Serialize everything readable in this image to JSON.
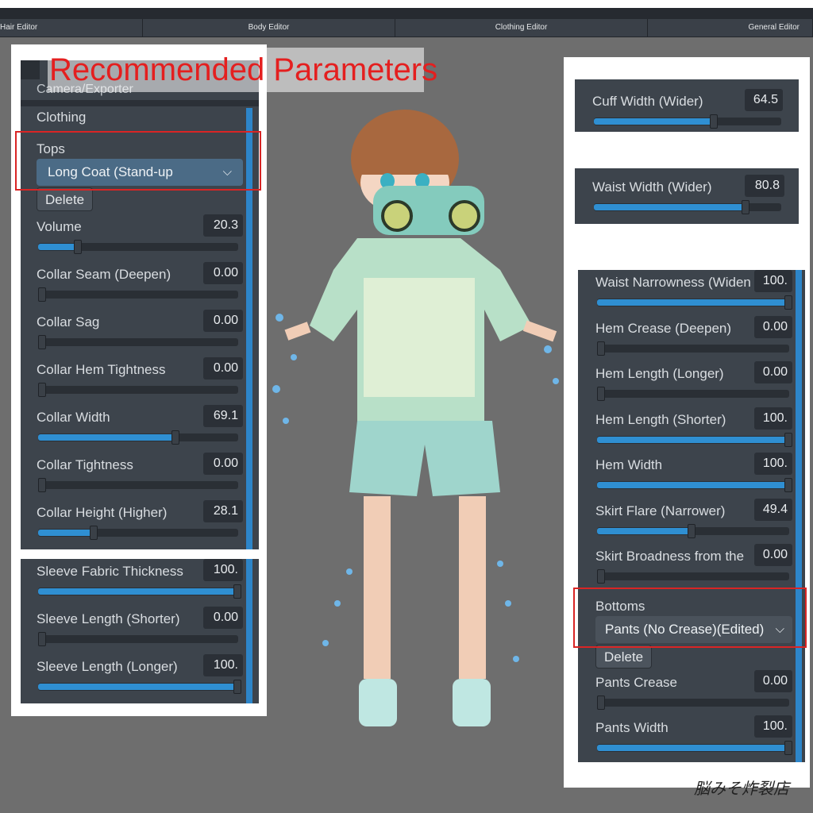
{
  "tabs": [
    "Hair Editor",
    "Body Editor",
    "Clothing Editor",
    "General Editor"
  ],
  "overlay_title": "Recommended  Parameters",
  "left": {
    "header_cut": "Camera/Exporter",
    "section": "Clothing",
    "tops_label": "Tops",
    "tops_value": "Long Coat (Stand-up",
    "delete_label": "Delete",
    "sliders": [
      {
        "label": "Volume",
        "value": "20.3",
        "fill": 0.203
      },
      {
        "label": "Collar Seam (Deepen)",
        "value": "0.00",
        "fill": 0
      },
      {
        "label": "Collar Sag",
        "value": "0.00",
        "fill": 0
      },
      {
        "label": "Collar Hem Tightness",
        "value": "0.00",
        "fill": 0
      },
      {
        "label": "Collar Width",
        "value": "69.1",
        "fill": 0.691
      },
      {
        "label": "Collar Tightness",
        "value": "0.00",
        "fill": 0
      },
      {
        "label": "Collar Height (Higher)",
        "value": "28.1",
        "fill": 0.281
      }
    ]
  },
  "left_bottom": {
    "sliders": [
      {
        "label": "Sleeve Fabric Thickness",
        "value": "100.",
        "fill": 1
      },
      {
        "label": "Sleeve Length (Shorter)",
        "value": "0.00",
        "fill": 0
      },
      {
        "label": "Sleeve Length (Longer)",
        "value": "100.",
        "fill": 1
      }
    ]
  },
  "right_top1": {
    "label": "Cuff Width (Wider)",
    "value": "64.5",
    "fill": 0.645
  },
  "right_top2": {
    "label": "Waist Width (Wider)",
    "value": "80.8",
    "fill": 0.808
  },
  "right": {
    "sliders": [
      {
        "label": "Waist Narrowness (Widen",
        "value": "100.",
        "fill": 1
      },
      {
        "label": "Hem Crease (Deepen)",
        "value": "0.00",
        "fill": 0
      },
      {
        "label": "Hem Length (Longer)",
        "value": "0.00",
        "fill": 0
      },
      {
        "label": "Hem Length (Shorter)",
        "value": "100.",
        "fill": 1
      },
      {
        "label": "Hem Width",
        "value": "100.",
        "fill": 1
      },
      {
        "label": "Skirt Flare (Narrower)",
        "value": "49.4",
        "fill": 0.494
      },
      {
        "label": "Skirt Broadness from the",
        "value": "0.00",
        "fill": 0
      }
    ],
    "bottoms_label": "Bottoms",
    "bottoms_value": "Pants (No Crease)(Edited)",
    "delete_label": "Delete",
    "sliders2": [
      {
        "label": "Pants Crease",
        "value": "0.00",
        "fill": 0
      },
      {
        "label": "Pants Width",
        "value": "100.",
        "fill": 1
      }
    ]
  },
  "watermark": "脳みそ炸裂店",
  "colors": {
    "accent": "#2f8fd2",
    "panel": "#3d444c",
    "highlight_box": "#d92525"
  }
}
